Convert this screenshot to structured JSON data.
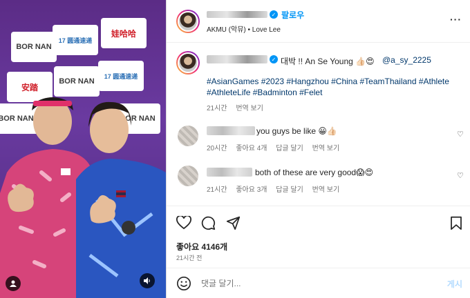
{
  "post": {
    "header": {
      "follow_label": "팔로우",
      "music": "AKMU (악뮤) • Love Lee",
      "more_icon": "more-horizontal-icon"
    },
    "caption": {
      "title_text": "대박 !! An Se Young 👍🏻😍",
      "mention": "@a_sy_2225",
      "hashtags_line1": "#AsianGames #2023 #Hangzhou #China #TeamThailand #Athlete",
      "hashtags_line2": "#AthleteLife #Badminton #Felet",
      "time": "21시간",
      "translate": "번역 보기"
    },
    "comments": [
      {
        "text": "you guys be like 😀👍🏻",
        "time": "20시간",
        "likes": "좋아요 4개",
        "reply": "답글 달기",
        "translate": "번역 보기"
      },
      {
        "text": "both of these are very good😱😍",
        "time": "21시간",
        "likes": "좋아요 3개",
        "reply": "답글 달기",
        "translate": "번역 보기"
      }
    ],
    "likes_count": "좋아요 4146개",
    "posted_ago": "21시간 전",
    "comment_placeholder": "댓글 달기...",
    "post_button": "게시"
  },
  "photo": {
    "sponsor_logos": [
      "BOR NAN",
      "17 圆通速递",
      "娃哈哈",
      "BOR NAN",
      "安踏",
      "BOR NAN",
      "17 圆通速递",
      "BOR NAN"
    ]
  },
  "colors": {
    "accent": "#0095f6",
    "hashtag": "#00376b",
    "muted": "#737373"
  }
}
